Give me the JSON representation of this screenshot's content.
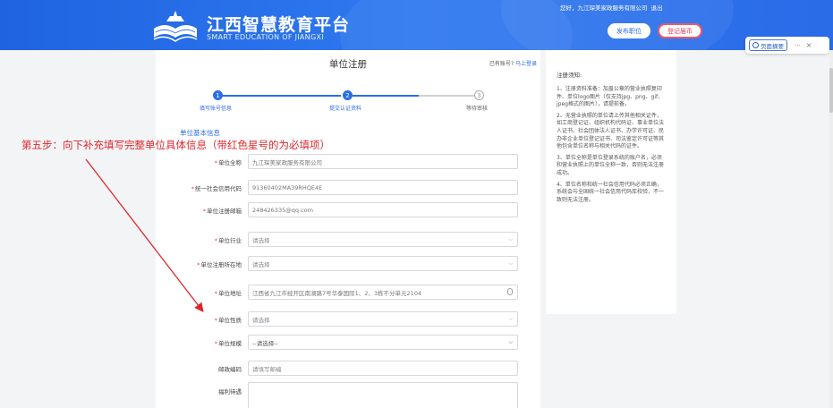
{
  "header": {
    "site_title": "江西智慧教育平台",
    "site_subtitle": "SMART EDUCATION OF JIANGXI",
    "greeting": "您好，九江琛美家政服务有限公司",
    "logout": "退出",
    "post_job_button": "发布职位",
    "register_button": "登记届币"
  },
  "extension": {
    "summary_button": "页面摘要",
    "more": "···",
    "close": "×"
  },
  "card": {
    "title": "单位注册",
    "has_account": "已有账号?",
    "login_link": "马上登录"
  },
  "steps": [
    {
      "num": "1",
      "label": "填写账号信息",
      "status": "done"
    },
    {
      "num": "2",
      "label": "提交认证资料",
      "status": "done"
    },
    {
      "num": "3",
      "label": "等待审核",
      "status": "todo"
    }
  ],
  "section_title": "单位基本信息",
  "form": {
    "fields": [
      {
        "label": "单位全称",
        "required": true,
        "value": "九江琛美家政服务有限公司",
        "type": "text"
      },
      {
        "label": "统一社会信用代码",
        "required": true,
        "value": "91360402MA39RHQE4E",
        "type": "text"
      },
      {
        "label": "单位注册邮箱",
        "required": true,
        "value": "248426335@qq.com",
        "type": "text"
      },
      {
        "label": "单位行业",
        "required": true,
        "value": "请选择",
        "type": "select"
      },
      {
        "label": "单位注册所在地",
        "required": true,
        "value": "请选择",
        "type": "select"
      },
      {
        "label": "单位地址",
        "required": true,
        "value": "江西省九江市经开区南湖路7号华泰国际1、2、3栋不分单元2104",
        "type": "address"
      },
      {
        "label": "单位性质",
        "required": true,
        "value": "请选择",
        "type": "select"
      },
      {
        "label": "单位规模",
        "required": true,
        "value": "--请选择--",
        "type": "select-dark"
      },
      {
        "label": "邮政编码",
        "required": false,
        "value": "请填写邮编",
        "type": "text"
      },
      {
        "label": "福利待遇",
        "required": false,
        "value": "",
        "type": "textarea"
      }
    ]
  },
  "notice": {
    "title": "注册须知:",
    "items": [
      "1、注册资料准备：加盖公章的营业执照复印件、单位logo图片（仅支持jpg、png、gif、jpeg格式的图片），请提前备。",
      "2、无营业执照的单位请上传其他相关证件，如工商登记证、组织机构代码证、事业单位法人证书、社会团体法人证书、办学许可证、民办非企业单位登记证书、司法鉴定许可证等其他包含单位名称与相关代码的证件。",
      "3、单位全称是单位登录系统的账户名，必须和营业执照上的单位全称一致，否则无法注册成功。",
      "4、单位名称和统一社会信用代码必须正确，系统会与全国统一社会信用代码库校验，不一致则无法注册。"
    ]
  },
  "annotation": "第五步：向下补充填写完整单位具体信息（带红色星号的为必填项）",
  "colors": {
    "primary": "#2b6de8",
    "required": "#e33b4e",
    "annotation": "#e0262b"
  }
}
